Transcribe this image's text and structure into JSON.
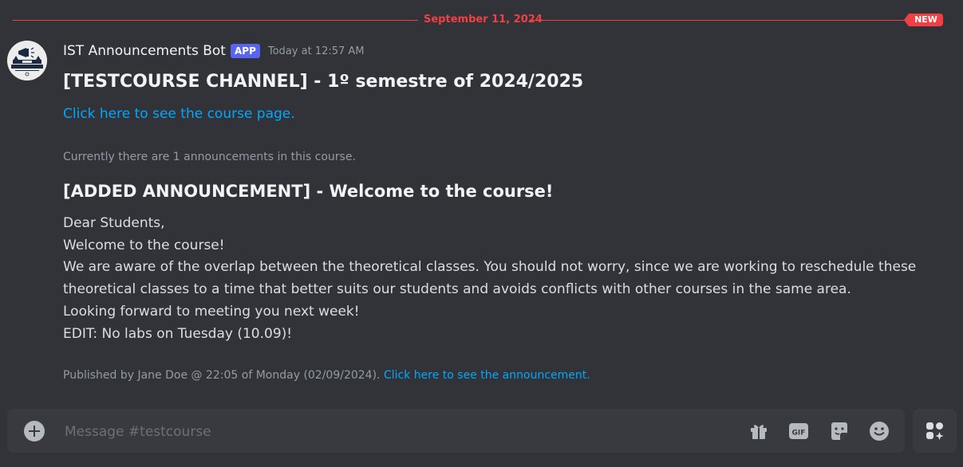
{
  "divider": {
    "date": "September 11, 2024",
    "new_badge": "NEW"
  },
  "message": {
    "avatar_label": "IST ANNOUNCEMENTS",
    "author": "IST Announcements Bot",
    "app_tag": "APP",
    "timestamp": "Today at 12:57 AM",
    "channel_title": "[TESTCOURSE CHANNEL] - 1º semestre of 2024/2025",
    "course_link": "Click here to see the course page.",
    "count_text": "Currently there are 1 announcements in this course.",
    "announcement_title": "[ADDED ANNOUNCEMENT] - Welcome to the course!",
    "body_lines": [
      "Dear Students,",
      "Welcome to the course!",
      "We are aware of the overlap between the theoretical classes. You should not worry, since we are working to reschedule these",
      "theoretical classes to a time that better suits our students and avoids conflicts with other courses in the same area.",
      "Looking forward to meeting you next week!",
      "EDIT: No labs on Tuesday (10.09)!"
    ],
    "footer_text": "Published by Jane Doe @ 22:05 of Monday (02/09/2024).",
    "footer_link": "Click here to see the announcement."
  },
  "composer": {
    "placeholder": "Message #testcourse",
    "icons": [
      "gift-icon",
      "gif-icon",
      "sticker-icon",
      "emoji-icon"
    ],
    "gif_label": "GIF"
  },
  "colors": {
    "background": "#313338",
    "accent_red": "#f23f43",
    "link": "#00a8fc",
    "app_tag": "#5865f2"
  }
}
